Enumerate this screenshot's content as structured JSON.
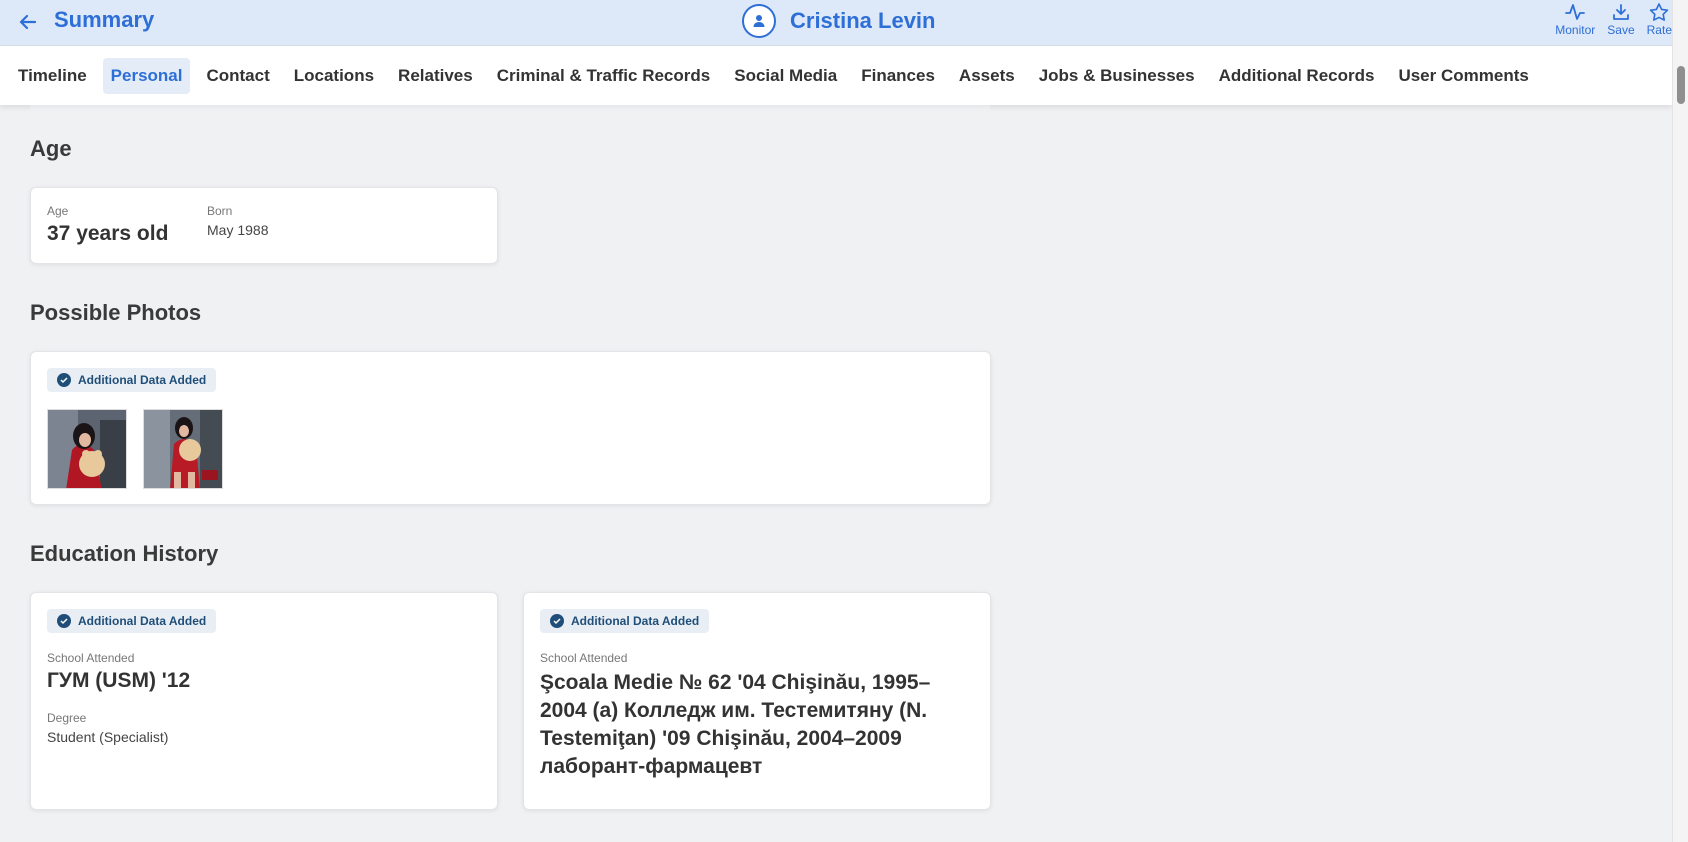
{
  "header": {
    "back_icon": "arrow-left-icon",
    "title": "Summary",
    "profile_name": "Cristina Levin",
    "actions": [
      {
        "label": "Monitor",
        "icon": "activity-icon"
      },
      {
        "label": "Save",
        "icon": "download-icon"
      },
      {
        "label": "Rate",
        "icon": "star-icon"
      }
    ]
  },
  "tabs": [
    {
      "label": "Timeline",
      "active": false
    },
    {
      "label": "Personal",
      "active": true
    },
    {
      "label": "Contact",
      "active": false
    },
    {
      "label": "Locations",
      "active": false
    },
    {
      "label": "Relatives",
      "active": false
    },
    {
      "label": "Criminal & Traffic Records",
      "active": false
    },
    {
      "label": "Social Media",
      "active": false
    },
    {
      "label": "Finances",
      "active": false
    },
    {
      "label": "Assets",
      "active": false
    },
    {
      "label": "Jobs & Businesses",
      "active": false
    },
    {
      "label": "Additional Records",
      "active": false
    },
    {
      "label": "User Comments",
      "active": false
    }
  ],
  "age": {
    "section_title": "Age",
    "age_label": "Age",
    "age_value": "37 years old",
    "born_label": "Born",
    "born_value": "May 1988"
  },
  "photos": {
    "section_title": "Possible Photos",
    "badge": "Additional Data Added"
  },
  "education": {
    "section_title": "Education History",
    "cards": [
      {
        "badge": "Additional Data Added",
        "school_label": "School Attended",
        "school": "ГУМ (USM) '12",
        "degree_label": "Degree",
        "degree": "Student (Specialist)"
      },
      {
        "badge": "Additional Data Added",
        "school_label": "School Attended",
        "school": "Şcoala Medie № 62 '04 Chişinău, 1995–2004 (a) Колледж им. Тестемитяну (N. Testemiţan) '09 Chişinău, 2004–2009 лаборант-фармацевт"
      }
    ]
  },
  "colors": {
    "accent": "#2d6fd6",
    "header_bg": "#dde8f8",
    "badge_text": "#1f4e79",
    "page_bg": "#f0f1f3"
  }
}
